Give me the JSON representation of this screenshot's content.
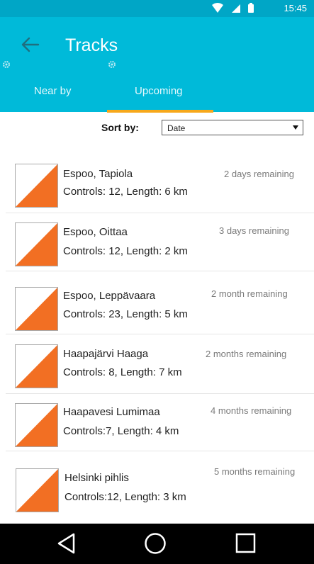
{
  "status_bar": {
    "time": "15:45",
    "icons": [
      "wifi-icon",
      "signal-icon",
      "battery-icon"
    ]
  },
  "app_bar": {
    "title": "Tracks",
    "tabs": [
      {
        "label": "Near by",
        "selected": false
      },
      {
        "label": "Upcoming",
        "selected": true
      }
    ]
  },
  "sort": {
    "label": "Sort by:",
    "selected": "Date"
  },
  "tracks": [
    {
      "name": "Espoo, Tapiola",
      "meta": "Controls: 12, Length: 6 km",
      "remaining": "2 days remaining"
    },
    {
      "name": "Espoo, Oittaa",
      "meta": "Controls: 12, Length: 2 km",
      "remaining": "3 days remaining"
    },
    {
      "name": "Espoo, Leppävaara",
      "meta": "Controls: 23, Length: 5 km",
      "remaining": "2 month remaining"
    },
    {
      "name": "Haapajärvi Haaga",
      "meta": "Controls: 8, Length: 7 km",
      "remaining": "2 months remaining"
    },
    {
      "name": "Haapavesi Lumimaa",
      "meta": "Controls:7, Length: 4 km",
      "remaining": "4 months remaining"
    },
    {
      "name": "Helsinki pihlis",
      "meta": "Controls:12, Length: 3 km",
      "remaining": "5 months remaining"
    }
  ],
  "colors": {
    "status_bar": "#00a6c6",
    "app_bar": "#00bad9",
    "tab_indicator": "#f7a81b",
    "control_flag": "#f26f23"
  },
  "nav_bar": [
    "back-nav-icon",
    "home-nav-icon",
    "recents-nav-icon"
  ]
}
